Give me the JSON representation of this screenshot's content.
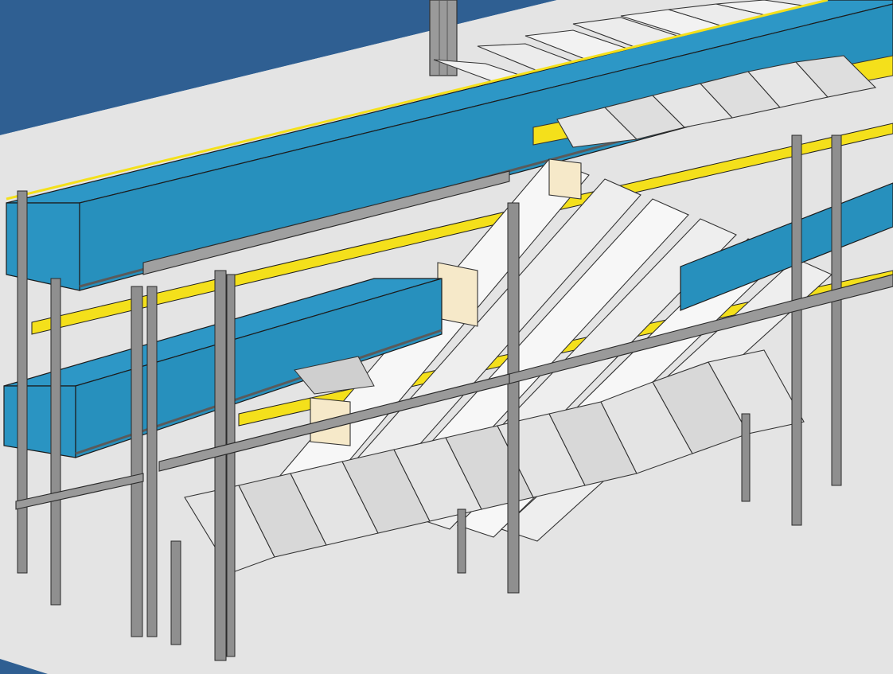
{
  "view": {
    "title": "",
    "labels": []
  },
  "colors": {
    "background": "#e9e9e9",
    "floor": "#e4e4e4",
    "wall": "#2f5f92",
    "conveyor_top": "#2d97c6",
    "conveyor_side": "#2790bd",
    "rail": "#f4e01b",
    "frame": "#8f8f8f",
    "chute": "#f2f2f2",
    "outline": "#303030"
  },
  "model": {
    "upper_conveyor": true,
    "lower_conveyor": true,
    "diverter_bays": 11,
    "bottom_bins": 10
  }
}
